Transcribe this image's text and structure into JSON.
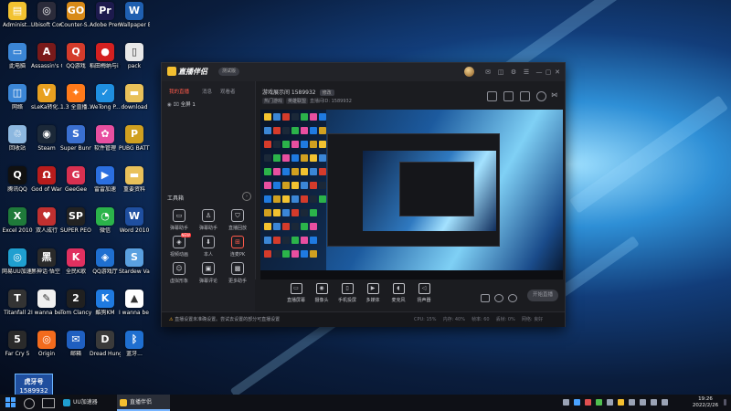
{
  "desktop": {
    "icons": [
      {
        "label": "Administ...",
        "color": "#f2c230",
        "glyph": "▤"
      },
      {
        "label": "Ubisoft Connect",
        "color": "#2b2b3a",
        "glyph": "◎"
      },
      {
        "label": "Counter-S... Global Off...",
        "color": "#d88a18",
        "glyph": "GO"
      },
      {
        "label": "Adobe Premie...",
        "color": "#1d1a4d",
        "glyph": "Pr"
      },
      {
        "label": "Wallpaper Engine:...",
        "color": "#1f5fb0",
        "glyph": "W"
      },
      {
        "label": "此电脑",
        "color": "#3b86d6",
        "glyph": "▭"
      },
      {
        "label": "Assassin's Creed V...",
        "color": "#7a1a1a",
        "glyph": "A"
      },
      {
        "label": "QQ游戏",
        "color": "#d43b2b",
        "glyph": "Q"
      },
      {
        "label": "稻田梅纳与i wanna be",
        "color": "#d42020",
        "glyph": "●"
      },
      {
        "label": "pack",
        "color": "#e8e8e8",
        "glyph": "▯"
      },
      {
        "label": "网络",
        "color": "#3b86d6",
        "glyph": "◫"
      },
      {
        "label": "sLeKa转化... IS",
        "color": "#e8a020",
        "glyph": "V"
      },
      {
        "label": "1.3 全直播...",
        "color": "#ff7a1a",
        "glyph": "✦"
      },
      {
        "label": "WeTong P...",
        "color": "#1f8fe0",
        "glyph": "✓"
      },
      {
        "label": "download",
        "color": "#e9c15a",
        "glyph": "▬"
      },
      {
        "label": "回收站",
        "color": "#8db8e0",
        "glyph": "♲"
      },
      {
        "label": "Steam",
        "color": "#1b2838",
        "glyph": "◉"
      },
      {
        "label": "Super Bunny Man",
        "color": "#3a6fd0",
        "glyph": "S"
      },
      {
        "label": "软件管理",
        "color": "#e84fa0",
        "glyph": "✿"
      },
      {
        "label": "PUBG BATTLEG...",
        "color": "#d0a020",
        "glyph": "P"
      },
      {
        "label": "腾讯QQ",
        "color": "#111111",
        "glyph": "Q"
      },
      {
        "label": "God of War",
        "color": "#b81c1c",
        "glyph": "Ω"
      },
      {
        "label": "GeeGee",
        "color": "#d83050",
        "glyph": "G"
      },
      {
        "label": "雷雷加速",
        "color": "#2b6fe0",
        "glyph": "▶"
      },
      {
        "label": "重要资料",
        "color": "#e9c15a",
        "glyph": "▬"
      },
      {
        "label": "Excel 2010",
        "color": "#1f7a3a",
        "glyph": "X"
      },
      {
        "label": "双人成行",
        "color": "#c03030",
        "glyph": "♥"
      },
      {
        "label": "SUPER PEOPLE CBT",
        "color": "#222222",
        "glyph": "SP"
      },
      {
        "label": "微信",
        "color": "#2bb34a",
        "glyph": "◔"
      },
      {
        "label": "Word 2010",
        "color": "#1f4fa0",
        "glyph": "W"
      },
      {
        "label": "网易UU加速器",
        "color": "#1f9fd0",
        "glyph": "◎"
      },
      {
        "label": "黑神话·悟空 BLACK",
        "color": "#2a2a2a",
        "glyph": "黑"
      },
      {
        "label": "全民K歌",
        "color": "#e03060",
        "glyph": "K"
      },
      {
        "label": "QQ游戏厅",
        "color": "#1f6fd0",
        "glyph": "◈"
      },
      {
        "label": "Stardew Valley",
        "color": "#5aa0e0",
        "glyph": "S"
      },
      {
        "label": "Titanfall 2",
        "color": "#333333",
        "glyph": "T"
      },
      {
        "label": "I wanna be the GUISS",
        "color": "#f0f0f0",
        "glyph": "✎"
      },
      {
        "label": "Tom Clancy's T...",
        "color": "#202020",
        "glyph": "2"
      },
      {
        "label": "酷狗KM",
        "color": "#1f7ae0",
        "glyph": "K"
      },
      {
        "label": "I wanna be the Creator",
        "color": "#ffffff",
        "glyph": "▲"
      },
      {
        "label": "Far Cry 5",
        "color": "#2a2a2a",
        "glyph": "5"
      },
      {
        "label": "Origin",
        "color": "#f26b1d",
        "glyph": "◎"
      },
      {
        "label": "邮箱",
        "color": "#1f5fc0",
        "glyph": "✉"
      },
      {
        "label": "Dread Hunger",
        "color": "#3a3a3a",
        "glyph": "D"
      },
      {
        "label": "蓝牙...",
        "color": "#1f6fd0",
        "glyph": "ᛒ"
      }
    ]
  },
  "streamer_tag": {
    "line1": "虎牙号",
    "line2": "1589932"
  },
  "app": {
    "name": "直播伴侣",
    "version_pill": "测试版",
    "left_tabs": [
      "我的直播",
      "消息",
      "观看者"
    ],
    "left_add": "+",
    "scene_label": "全屏 1",
    "tools_title": "工具箱",
    "tools": [
      {
        "label": "弹幕助手",
        "glyph": "▭",
        "hot": false
      },
      {
        "label": "弹幕助手",
        "glyph": "♙",
        "hot": false
      },
      {
        "label": "直播回放",
        "glyph": "⛉",
        "hot": false
      },
      {
        "label": "视频动画",
        "glyph": "◈",
        "hot": false
      },
      {
        "label": "本人",
        "glyph": "⬇",
        "hot": false
      },
      {
        "label": "连麦PK",
        "glyph": "⊞",
        "hot": true
      },
      {
        "label": "虚拟形象",
        "glyph": "☺",
        "hot": false
      },
      {
        "label": "弹幕评论",
        "glyph": "▣",
        "hot": false
      },
      {
        "label": "更多助手",
        "glyph": "▩",
        "hot": false
      }
    ],
    "new_badge": "NEW",
    "room_title": "游戏展示间 1589932",
    "room_pill": "修改",
    "sub_chips": [
      "热门游戏",
      "英雄联盟"
    ],
    "sub_text": "直播间ID: 1589932",
    "controls": [
      {
        "label": "直播屏幕",
        "glyph": "▭"
      },
      {
        "label": "摄像头",
        "glyph": "◉"
      },
      {
        "label": "手机投屏",
        "glyph": "▯"
      },
      {
        "label": "多媒体",
        "glyph": "▶"
      },
      {
        "label": "麦克风",
        "glyph": "◖"
      },
      {
        "label": "扬声器",
        "glyph": "◁"
      }
    ],
    "go_live_label": "开始直播",
    "status_warning": "⚠",
    "status_text": "直播设置未准确设置。尝试去设置的部分可直播设置",
    "status_stats": [
      "CPU: 15%",
      "内存: 40%",
      "帧率: 60",
      "丢帧: 0%",
      "网络: 良好"
    ]
  },
  "taskbar": {
    "items": [
      {
        "label": "UU加速器",
        "color": "#1f9fd0",
        "active": false
      },
      {
        "label": "直播伴侣",
        "color": "#f5c030",
        "active": true
      }
    ],
    "clock_time": "19:26",
    "clock_date": "2022/2/26"
  }
}
